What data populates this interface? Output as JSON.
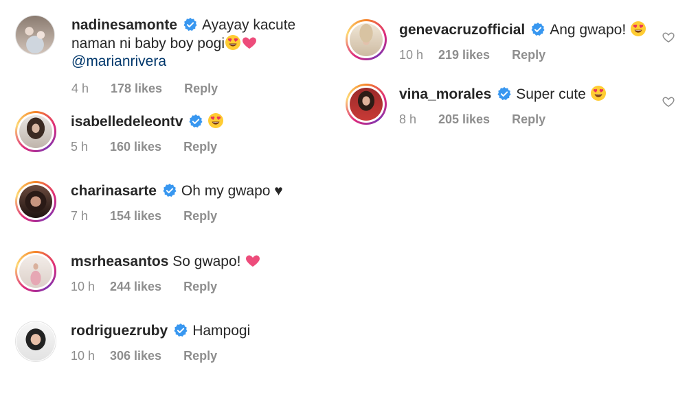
{
  "comments_left": [
    {
      "user": "nadinesamonte",
      "text": "Ayayay kacute naman ni baby boy pogi",
      "mention": "@marianrivera",
      "time": "4 h",
      "likes": "178 likes",
      "reply": "Reply"
    },
    {
      "user": "isabelledeleontv",
      "text": "",
      "time": "5 h",
      "likes": "160 likes",
      "reply": "Reply"
    },
    {
      "user": "charinasarte",
      "text": "Oh my gwapo ♥",
      "time": "7 h",
      "likes": "154 likes",
      "reply": "Reply"
    },
    {
      "user": "msrheasantos",
      "text": "So gwapo!",
      "time": "10 h",
      "likes": "244 likes",
      "reply": "Reply"
    },
    {
      "user": "rodriguezruby",
      "text": "Hampogi",
      "time": "10 h",
      "likes": "306 likes",
      "reply": "Reply"
    }
  ],
  "comments_right": [
    {
      "user": "genevacruzofficial",
      "text": "Ang gwapo!",
      "time": "10 h",
      "likes": "219 likes",
      "reply": "Reply"
    },
    {
      "user": "vina_morales",
      "text": "Super cute",
      "time": "8 h",
      "likes": "205 likes",
      "reply": "Reply"
    }
  ],
  "colors": {
    "verified": "#3897f0",
    "heart_pink": "#ed4c7b",
    "muted": "#8e8e8e"
  },
  "icons": {
    "verified": "verified-badge-icon",
    "heart_eyes": "heart-eyes-emoji-icon",
    "pink_heart": "pink-heart-icon",
    "like": "heart-outline-icon"
  }
}
